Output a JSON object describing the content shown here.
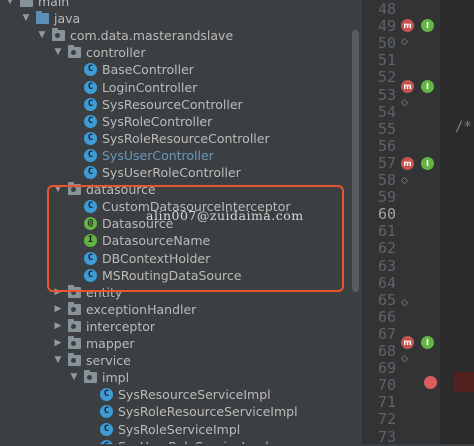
{
  "tree": [
    {
      "type": "folder",
      "name": "main",
      "expanded": true,
      "depth": 0
    },
    {
      "type": "folder",
      "name": "java",
      "expanded": true,
      "depth": 1,
      "color": "blue"
    },
    {
      "type": "package",
      "name": "com.data.masterandslave",
      "expanded": true,
      "depth": 2
    },
    {
      "type": "package",
      "name": "controller",
      "expanded": true,
      "depth": 3
    },
    {
      "type": "class",
      "name": "BaseController",
      "depth": 4
    },
    {
      "type": "class",
      "name": "LoginController",
      "depth": 4
    },
    {
      "type": "class",
      "name": "SysResourceController",
      "depth": 4
    },
    {
      "type": "class",
      "name": "SysRoleController",
      "depth": 4
    },
    {
      "type": "class",
      "name": "SysRoleResourceController",
      "depth": 4
    },
    {
      "type": "class",
      "name": "SysUserController",
      "depth": 4,
      "selected": true
    },
    {
      "type": "class",
      "name": "SysUserRoleController",
      "depth": 4
    },
    {
      "type": "package",
      "name": "datasource",
      "expanded": true,
      "depth": 3
    },
    {
      "type": "class",
      "name": "CustomDatasourceInterceptor",
      "depth": 4
    },
    {
      "type": "annotation",
      "name": "Datasource",
      "depth": 4
    },
    {
      "type": "interface",
      "name": "DatasourceName",
      "depth": 4
    },
    {
      "type": "class",
      "name": "DBContextHolder",
      "depth": 4
    },
    {
      "type": "class",
      "name": "MSRoutingDataSource",
      "depth": 4
    },
    {
      "type": "package",
      "name": "entity",
      "expanded": false,
      "depth": 3
    },
    {
      "type": "package",
      "name": "exceptionHandler",
      "expanded": false,
      "depth": 3
    },
    {
      "type": "package",
      "name": "interceptor",
      "expanded": false,
      "depth": 3
    },
    {
      "type": "package",
      "name": "mapper",
      "expanded": false,
      "depth": 3
    },
    {
      "type": "package",
      "name": "service",
      "expanded": true,
      "depth": 3
    },
    {
      "type": "package",
      "name": "impl",
      "expanded": true,
      "depth": 4
    },
    {
      "type": "class",
      "name": "SysResourceServiceImpl",
      "depth": 5
    },
    {
      "type": "class",
      "name": "SysRoleResourceServiceImpl",
      "depth": 5
    },
    {
      "type": "class",
      "name": "SysRoleServiceImpl",
      "depth": 5
    },
    {
      "type": "class",
      "name": "SysUserRoleServiceImpl",
      "depth": 5
    }
  ],
  "gutter": {
    "lines": [
      "48",
      "49",
      "50",
      "51",
      "52",
      "53",
      "54",
      "55",
      "56",
      "57",
      "58",
      "59",
      "60",
      "61",
      "62",
      "63",
      "64",
      "65",
      "66",
      "67",
      "68",
      "69",
      "70",
      "71",
      "72",
      "73"
    ],
    "comment_text": "/*"
  },
  "watermark": "alin007@zuidaima.com",
  "colors": {
    "highlight": "#e8542e",
    "selected_text": "#6897bb"
  }
}
